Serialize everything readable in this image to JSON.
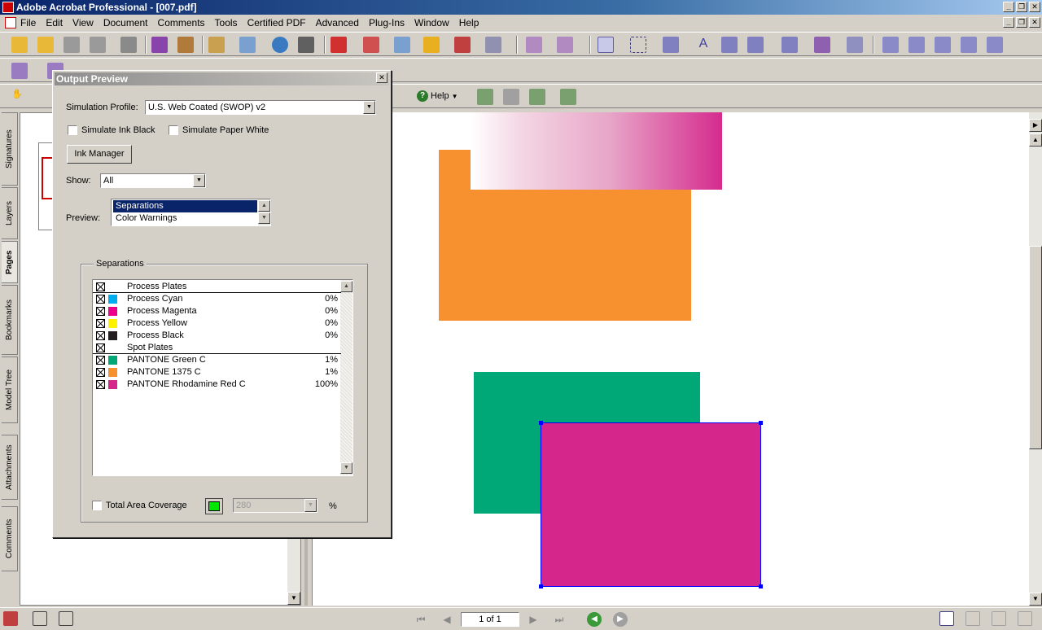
{
  "window": {
    "title": "Adobe Acrobat Professional - [007.pdf]"
  },
  "menu": [
    "File",
    "Edit",
    "View",
    "Document",
    "Comments",
    "Tools",
    "Certified PDF",
    "Advanced",
    "Plug-Ins",
    "Window",
    "Help"
  ],
  "toolbar": {
    "help_label": "Help"
  },
  "navigation_tabs": [
    "Signatures",
    "Layers",
    "Pages",
    "Bookmarks",
    "Model Tree",
    "Attachments",
    "Comments"
  ],
  "active_tab": "Pages",
  "dialog": {
    "title": "Output Preview",
    "simulation_profile_label": "Simulation Profile:",
    "simulation_profile_value": "U.S. Web Coated (SWOP) v2",
    "simulate_ink_black": "Simulate Ink Black",
    "simulate_paper_white": "Simulate Paper White",
    "ink_manager": "Ink Manager",
    "show_label": "Show:",
    "show_value": "All",
    "preview_label": "Preview:",
    "preview_options": [
      "Separations",
      "Color Warnings"
    ],
    "preview_selected": "Separations",
    "separations_group": "Separations",
    "separations": [
      {
        "name": "Process Plates",
        "header": true,
        "color": "",
        "pct": ""
      },
      {
        "name": "Process Cyan",
        "header": false,
        "color": "#00aeef",
        "pct": "0%"
      },
      {
        "name": "Process Magenta",
        "header": false,
        "color": "#ec008c",
        "pct": "0%"
      },
      {
        "name": "Process Yellow",
        "header": false,
        "color": "#fff200",
        "pct": "0%"
      },
      {
        "name": "Process Black",
        "header": false,
        "color": "#231f20",
        "pct": "0%"
      },
      {
        "name": "Spot Plates",
        "header": true,
        "color": "",
        "pct": ""
      },
      {
        "name": "PANTONE Green C",
        "header": false,
        "color": "#00a878",
        "pct": "1%"
      },
      {
        "name": "PANTONE 1375 C",
        "header": false,
        "color": "#f7912f",
        "pct": "1%"
      },
      {
        "name": "PANTONE Rhodamine Red C",
        "header": false,
        "color": "#d5268c",
        "pct": "100%"
      }
    ],
    "total_area_coverage": "Total Area Coverage",
    "coverage_value": "280",
    "coverage_unit": "%"
  },
  "status": {
    "page_field": "1 of 1"
  },
  "colors": {
    "orange": "#f7912f",
    "green": "#00a878",
    "rhodamine": "#d5268c",
    "selection": "#0000ff"
  }
}
